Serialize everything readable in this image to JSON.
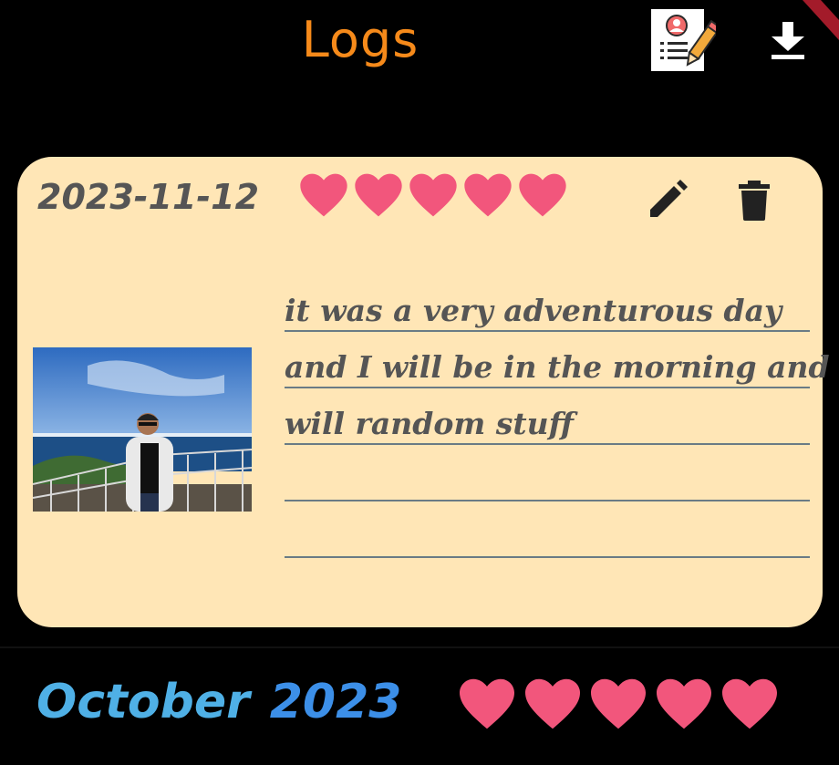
{
  "header": {
    "title": "Logs",
    "title_color": "#f68a1a",
    "profile_icon": "profile-edit-icon",
    "download_icon": "download-icon"
  },
  "entry": {
    "date": "2023-11-12",
    "rating": 5,
    "rating_max": 5,
    "heart_color": "#f2567c",
    "text_lines": [
      "it was a very adventurous day",
      "and I will be in the morning and",
      "will random stuff",
      "",
      ""
    ],
    "edit_icon": "pencil-icon",
    "delete_icon": "trash-icon",
    "card_color": "#ffe6b6"
  },
  "month_summary": {
    "month": "October",
    "year": "2023",
    "rating": 5
  }
}
